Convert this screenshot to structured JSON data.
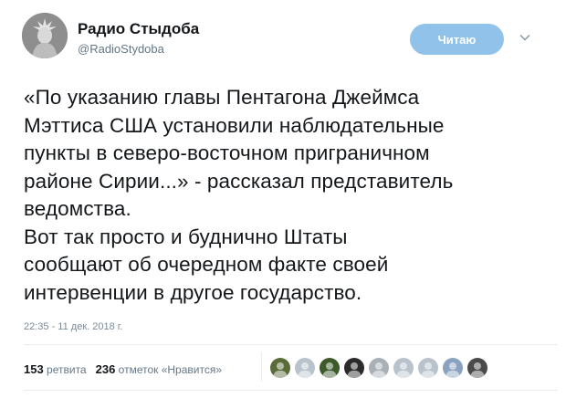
{
  "author": {
    "display_name": "Радио Стыдоба",
    "handle": "@RadioStydoba"
  },
  "follow_button": {
    "label": "Читаю"
  },
  "icons": {
    "more": "chevron-down-icon"
  },
  "tweet": {
    "lines": [
      "«По указанию главы Пентагона Джеймса",
      "Мэттиса США установили наблюдательные",
      "пункты в северо-восточном приграничном",
      "районе Сирии...» - рассказал представитель",
      "ведомства.",
      "Вот так просто и буднично Штаты",
      "сообщают об очередном факте своей",
      "интервенции в другое государство."
    ],
    "timestamp": "22:35 - 11 дек. 2018 г."
  },
  "stats": {
    "retweets_count": "153",
    "retweets_label": "ретвита",
    "likes_count": "236",
    "likes_label": "отметок «Нравится»"
  },
  "likers": [
    {
      "name": "liker-avatar-1",
      "color": "#5a6b3a"
    },
    {
      "name": "liker-avatar-2",
      "color": "#b8c3cc"
    },
    {
      "name": "liker-avatar-3",
      "color": "#3c5a2a"
    },
    {
      "name": "liker-avatar-4",
      "color": "#2b2b2b"
    },
    {
      "name": "liker-avatar-5",
      "color": "#a9b0b6"
    },
    {
      "name": "liker-avatar-6",
      "color": "#b8c3cc"
    },
    {
      "name": "liker-avatar-7",
      "color": "#b8c3cc"
    },
    {
      "name": "liker-avatar-8",
      "color": "#8aa2c0"
    },
    {
      "name": "liker-avatar-9",
      "color": "#4a4a4a"
    }
  ],
  "colors": {
    "follow_button_bg": "#90c2ea",
    "muted_text": "#657786",
    "divider": "#e6ecf0"
  }
}
